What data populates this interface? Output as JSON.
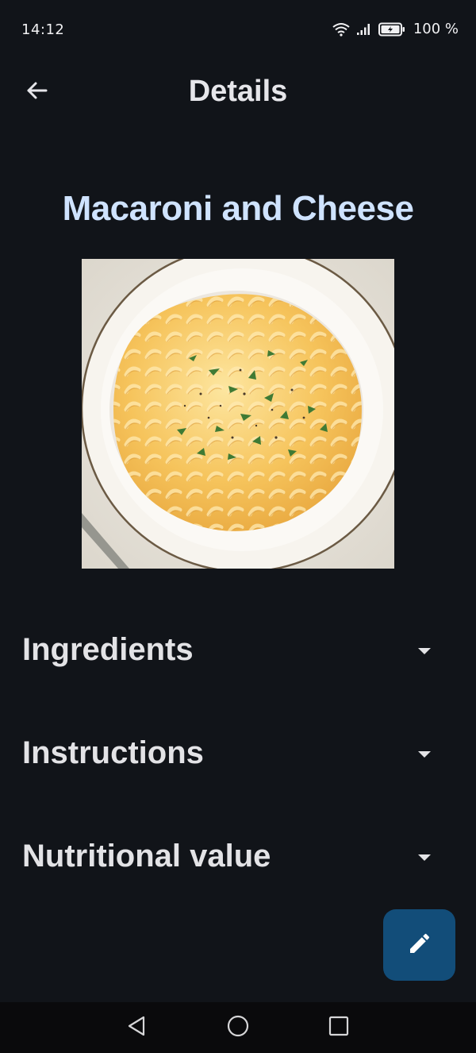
{
  "status_bar": {
    "time": "14:12",
    "battery": "100 %",
    "icons": [
      "wifi-icon",
      "signal-icon",
      "battery-icon"
    ]
  },
  "app_bar": {
    "title": "Details",
    "back_icon": "arrow-left-icon"
  },
  "recipe": {
    "title": "Macaroni and Cheese",
    "image_alt": "Macaroni and Cheese"
  },
  "sections": [
    {
      "label": "Ingredients",
      "icon": "caret-down-icon"
    },
    {
      "label": "Instructions",
      "icon": "caret-down-icon"
    },
    {
      "label": "Nutritional value",
      "icon": "caret-down-icon"
    }
  ],
  "fab": {
    "icon": "pencil-icon"
  },
  "nav_bar": {
    "icons": [
      "back-triangle-icon",
      "home-circle-icon",
      "recents-square-icon"
    ]
  },
  "colors": {
    "background": "#111419",
    "title_accent": "#cfe3ff",
    "fab": "#124d79",
    "text": "#e3e3e6"
  }
}
